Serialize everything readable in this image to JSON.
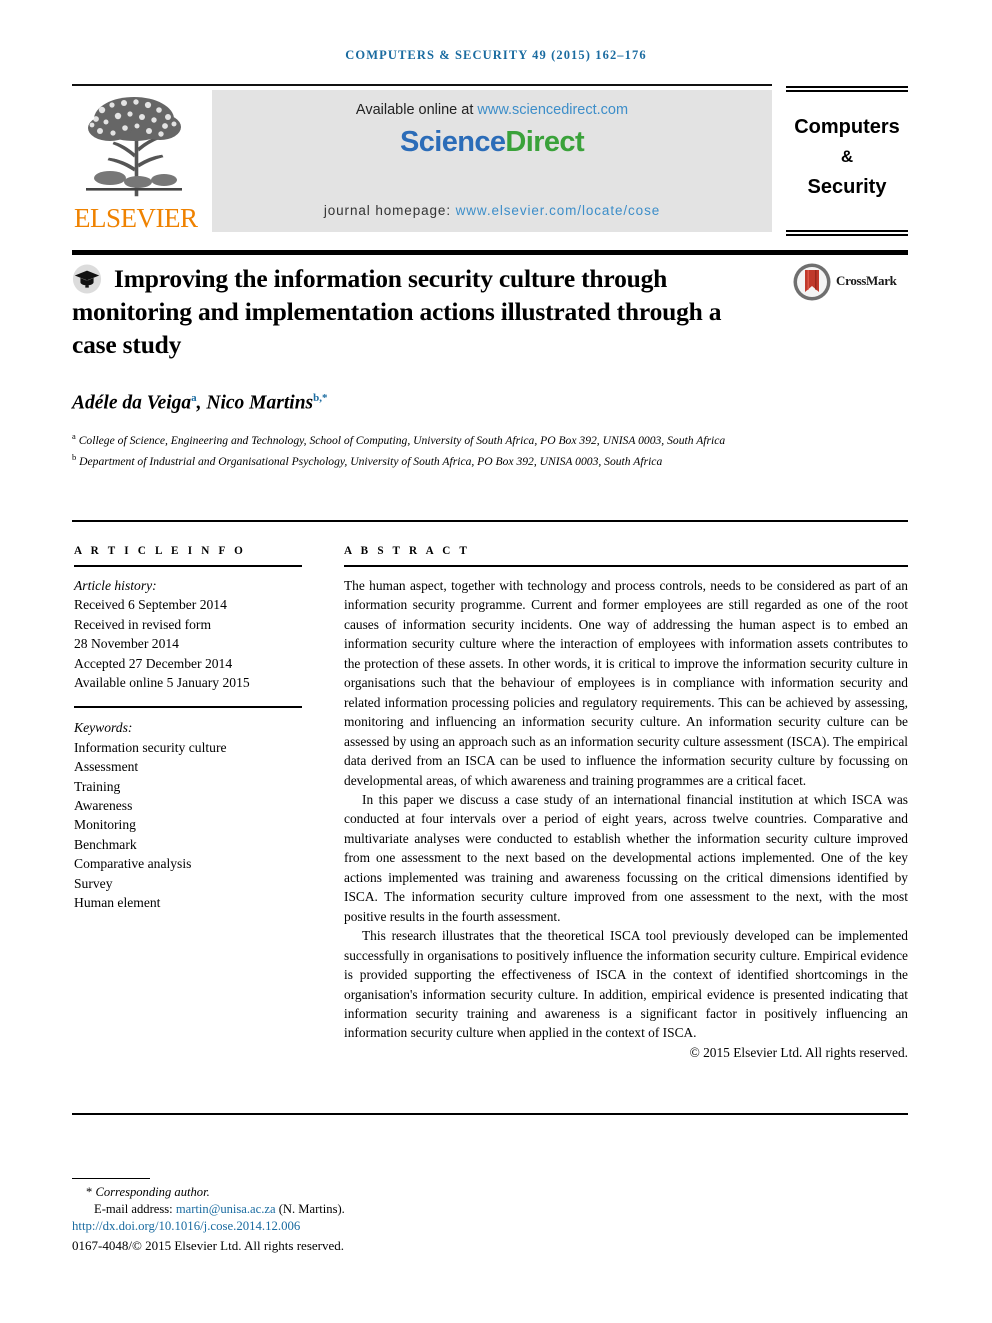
{
  "running_head": "COMPUTERS & SECURITY 49 (2015) 162–176",
  "masthead": {
    "publisher_logo_text": "ELSEVIER",
    "available_online_prefix": "Available online at ",
    "available_online_link": "www.sciencedirect.com",
    "sciencedirect_part1": "Science",
    "sciencedirect_part2": "Direct",
    "homepage_prefix": "journal homepage: ",
    "homepage_link": "www.elsevier.com/locate/cose",
    "journal_line1": "Computers",
    "journal_line2": "&",
    "journal_line3": "Security"
  },
  "article": {
    "title": "Improving the information security culture through monitoring and implementation actions illustrated through a case study",
    "crossmark_label": "CrossMark",
    "authors": [
      {
        "name": "Adéle da Veiga",
        "marks": "a"
      },
      {
        "name": "Nico Martins",
        "marks": "b,*"
      }
    ],
    "affiliations": [
      {
        "mark": "a",
        "text": "College of Science, Engineering and Technology, School of Computing, University of South Africa, PO Box 392, UNISA 0003, South Africa"
      },
      {
        "mark": "b",
        "text": "Department of Industrial and Organisational Psychology, University of South Africa, PO Box 392, UNISA 0003, South Africa"
      }
    ]
  },
  "article_info": {
    "heading": "A R T I C L E   I N F O",
    "history_label": "Article history:",
    "history": [
      "Received 6 September 2014",
      "Received in revised form",
      "28 November 2014",
      "Accepted 27 December 2014",
      "Available online 5 January 2015"
    ],
    "keywords_label": "Keywords:",
    "keywords": [
      "Information security culture",
      "Assessment",
      "Training",
      "Awareness",
      "Monitoring",
      "Benchmark",
      "Comparative analysis",
      "Survey",
      "Human element"
    ]
  },
  "abstract": {
    "heading": "A B S T R A C T",
    "paragraphs": [
      "The human aspect, together with technology and process controls, needs to be considered as part of an information security programme. Current and former employees are still regarded as one of the root causes of information security incidents. One way of addressing the human aspect is to embed an information security culture where the interaction of employees with information assets contributes to the protection of these assets. In other words, it is critical to improve the information security culture in organisations such that the behaviour of employees is in compliance with information security and related information processing policies and regulatory requirements. This can be achieved by assessing, monitoring and influencing an information security culture. An information security culture can be assessed by using an approach such as an information security culture assessment (ISCA). The empirical data derived from an ISCA can be used to influence the information security culture by focussing on developmental areas, of which awareness and training programmes are a critical facet.",
      "In this paper we discuss a case study of an international financial institution at which ISCA was conducted at four intervals over a period of eight years, across twelve countries. Comparative and multivariate analyses were conducted to establish whether the information security culture improved from one assessment to the next based on the developmental actions implemented. One of the key actions implemented was training and awareness focussing on the critical dimensions identified by ISCA. The information security culture improved from one assessment to the next, with the most positive results in the fourth assessment.",
      "This research illustrates that the theoretical ISCA tool previously developed can be implemented successfully in organisations to positively influence the information security culture. Empirical evidence is provided supporting the effectiveness of ISCA in the context of identified shortcomings in the organisation's information security culture. In addition, empirical evidence is presented indicating that information security training and awareness is a significant factor in positively influencing an information security culture when applied in the context of ISCA."
    ],
    "copyright": "© 2015 Elsevier Ltd. All rights reserved."
  },
  "footer": {
    "corresponding_star": "*",
    "corresponding_text": " Corresponding author.",
    "email_label": "E-mail address: ",
    "email": "martin@unisa.ac.za",
    "email_suffix": " (N. Martins).",
    "doi": "http://dx.doi.org/10.1016/j.cose.2014.12.006",
    "issn_line": "0167-4048/© 2015 Elsevier Ltd. All rights reserved."
  },
  "colors": {
    "link_blue": "#3d8ec9",
    "header_blue": "#1a6ba0",
    "elsevier_orange": "#ef8200",
    "science_blue": "#2b6cb8",
    "direct_green": "#3aa23a",
    "banner_gray": "#e3e3e3"
  }
}
